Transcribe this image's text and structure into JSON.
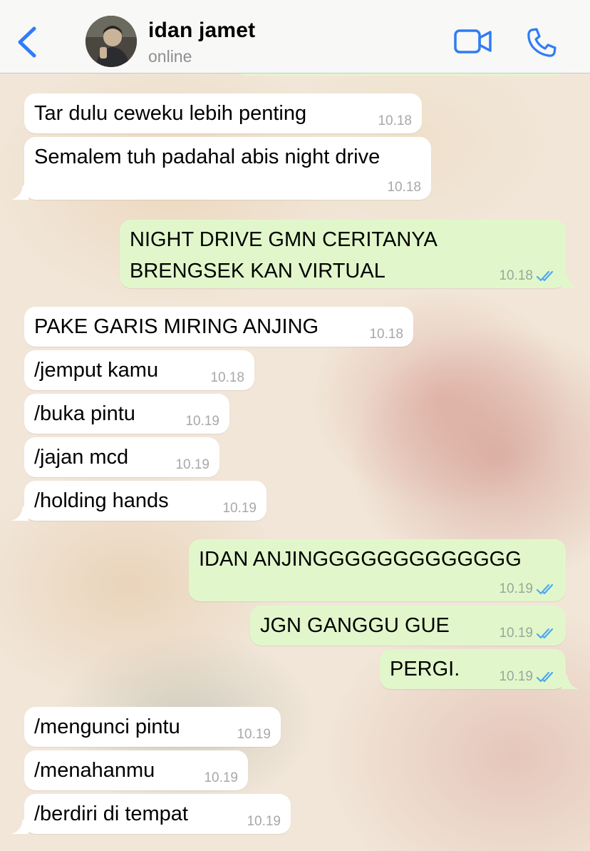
{
  "header": {
    "contact_name": "idan jamet",
    "status": "online"
  },
  "colors": {
    "accent": "#2f7cf6",
    "outgoing_bubble": "#e1f7cb",
    "incoming_bubble": "#ffffff",
    "read_ticks": "#4fa8f1"
  },
  "messages": [
    {
      "direction": "in",
      "text": "Tar dulu ceweku lebih penting",
      "time": "10.18"
    },
    {
      "direction": "in",
      "text": "Semalem tuh padahal abis night drive",
      "time": "10.18"
    },
    {
      "direction": "out",
      "line1": "NIGHT DRIVE GMN CERITANYA",
      "line2": "BRENGSEK KAN VIRTUAL",
      "time": "10.18",
      "read": true
    },
    {
      "direction": "in",
      "text": "PAKE GARIS MIRING ANJING",
      "time": "10.18"
    },
    {
      "direction": "in",
      "text": "/jemput kamu",
      "time": "10.18"
    },
    {
      "direction": "in",
      "text": "/buka pintu",
      "time": "10.19"
    },
    {
      "direction": "in",
      "text": "/jajan mcd",
      "time": "10.19"
    },
    {
      "direction": "in",
      "text": "/holding hands",
      "time": "10.19"
    },
    {
      "direction": "out",
      "text": "IDAN ANJINGGGGGGGGGGGGG",
      "time": "10.19",
      "read": true
    },
    {
      "direction": "out",
      "text": "JGN GANGGU GUE",
      "time": "10.19",
      "read": true
    },
    {
      "direction": "out",
      "text": "PERGI.",
      "time": "10.19",
      "read": true
    },
    {
      "direction": "in",
      "text": "/mengunci pintu",
      "time": "10.19"
    },
    {
      "direction": "in",
      "text": "/menahanmu",
      "time": "10.19"
    },
    {
      "direction": "in",
      "text": "/berdiri di tempat",
      "time": "10.19"
    }
  ]
}
